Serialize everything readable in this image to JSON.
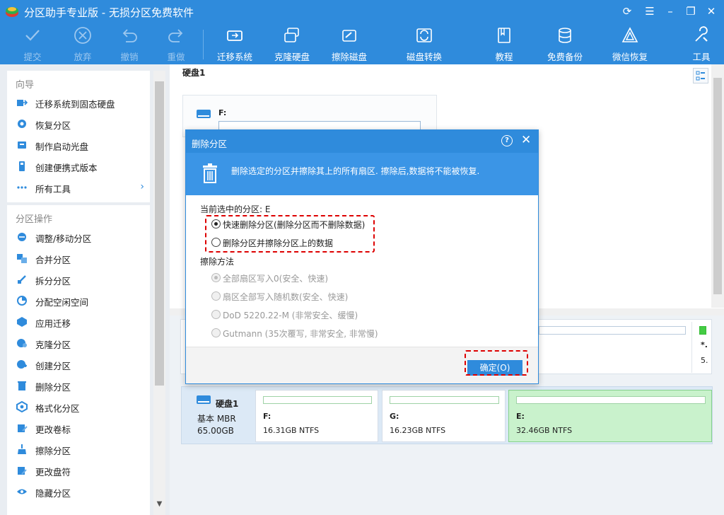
{
  "window": {
    "title": "分区助手专业版 - 无损分区免费软件",
    "controls": [
      "refresh-icon",
      "menu-icon",
      "minimize-icon",
      "maximize-icon",
      "close-icon"
    ]
  },
  "toolbar": {
    "items": [
      {
        "label": "提交",
        "icon": "check-icon",
        "enabled": false
      },
      {
        "label": "放弃",
        "icon": "cancel-icon",
        "enabled": false
      },
      {
        "label": "撤销",
        "icon": "undo-icon",
        "enabled": false
      },
      {
        "label": "重做",
        "icon": "redo-icon",
        "enabled": false
      },
      {
        "label": "迁移系统",
        "icon": "migrate-os-icon",
        "enabled": true
      },
      {
        "label": "克隆硬盘",
        "icon": "clone-disk-icon",
        "enabled": true
      },
      {
        "label": "擦除磁盘",
        "icon": "wipe-disk-icon",
        "enabled": true
      },
      {
        "label": "磁盘转换",
        "icon": "disk-convert-icon",
        "enabled": true
      },
      {
        "label": "教程",
        "icon": "book-icon",
        "enabled": true
      },
      {
        "label": "免费备份",
        "icon": "backup-icon",
        "enabled": true
      },
      {
        "label": "微信恢复",
        "icon": "wechat-recovery-icon",
        "enabled": true
      },
      {
        "label": "工具",
        "icon": "tools-icon",
        "enabled": true
      }
    ]
  },
  "sidebar": {
    "wizard": {
      "title": "向导",
      "items": [
        {
          "label": "迁移系统到固态硬盘",
          "icon": "ssd-migrate-icon"
        },
        {
          "label": "恢复分区",
          "icon": "recover-icon"
        },
        {
          "label": "制作启动光盘",
          "icon": "boot-disc-icon"
        },
        {
          "label": "创建便携式版本",
          "icon": "portable-icon"
        },
        {
          "label": "所有工具",
          "icon": "all-tools-icon",
          "chevron": "›"
        }
      ]
    },
    "partition_ops": {
      "title": "分区操作",
      "items": [
        {
          "label": "调整/移动分区",
          "icon": "resize-icon"
        },
        {
          "label": "合并分区",
          "icon": "merge-icon"
        },
        {
          "label": "拆分分区",
          "icon": "split-icon"
        },
        {
          "label": "分配空闲空间",
          "icon": "allocate-icon"
        },
        {
          "label": "应用迁移",
          "icon": "app-migrate-icon"
        },
        {
          "label": "克隆分区",
          "icon": "clone-partition-icon"
        },
        {
          "label": "创建分区",
          "icon": "create-partition-icon"
        },
        {
          "label": "删除分区",
          "icon": "delete-partition-icon"
        },
        {
          "label": "格式化分区",
          "icon": "format-icon"
        },
        {
          "label": "更改卷标",
          "icon": "label-icon"
        },
        {
          "label": "擦除分区",
          "icon": "wipe-partition-icon"
        },
        {
          "label": "更改盘符",
          "icon": "drive-letter-icon"
        },
        {
          "label": "隐藏分区",
          "icon": "hide-icon"
        }
      ]
    }
  },
  "main": {
    "disk_header": "硬盘1",
    "top_partition_label": "F:",
    "mid_partial": [
      "*.",
      "5."
    ],
    "disk_row": {
      "name": "硬盘1",
      "type": "基本 MBR",
      "size": "65.00GB",
      "partitions": [
        {
          "letter": "F:",
          "size": "16.31GB NTFS",
          "selected": false
        },
        {
          "letter": "G:",
          "size": "16.23GB NTFS",
          "selected": false
        },
        {
          "letter": "E:",
          "size": "32.46GB NTFS",
          "selected": true
        }
      ]
    }
  },
  "dialog": {
    "title": "删除分区",
    "help": "?",
    "close": "✕",
    "banner": "删除选定的分区并擦除其上的所有扇区. 擦除后,数据将不能被恢复.",
    "current_partition": "当前选中的分区: E",
    "options": [
      {
        "label": "快速删除分区(删除分区而不删除数据)",
        "checked": true
      },
      {
        "label": "删除分区并擦除分区上的数据",
        "checked": false
      }
    ],
    "wipe_method_label": "擦除方法",
    "wipe_methods": [
      {
        "label": "全部扇区写入0(安全、快速)",
        "checked": true,
        "enabled": false
      },
      {
        "label": "扇区全部写入随机数(安全、快速)",
        "checked": false,
        "enabled": false
      },
      {
        "label": "DoD 5220.22-M (非常安全、缓慢)",
        "checked": false,
        "enabled": false
      },
      {
        "label": "Gutmann (35次覆写, 非常安全, 非常慢)",
        "checked": false,
        "enabled": false
      }
    ],
    "ok_label": "确定(O)"
  },
  "colors": {
    "accent": "#2f8bdc",
    "selected_partition": "#c9f2cc",
    "highlight": "#dd0000"
  }
}
